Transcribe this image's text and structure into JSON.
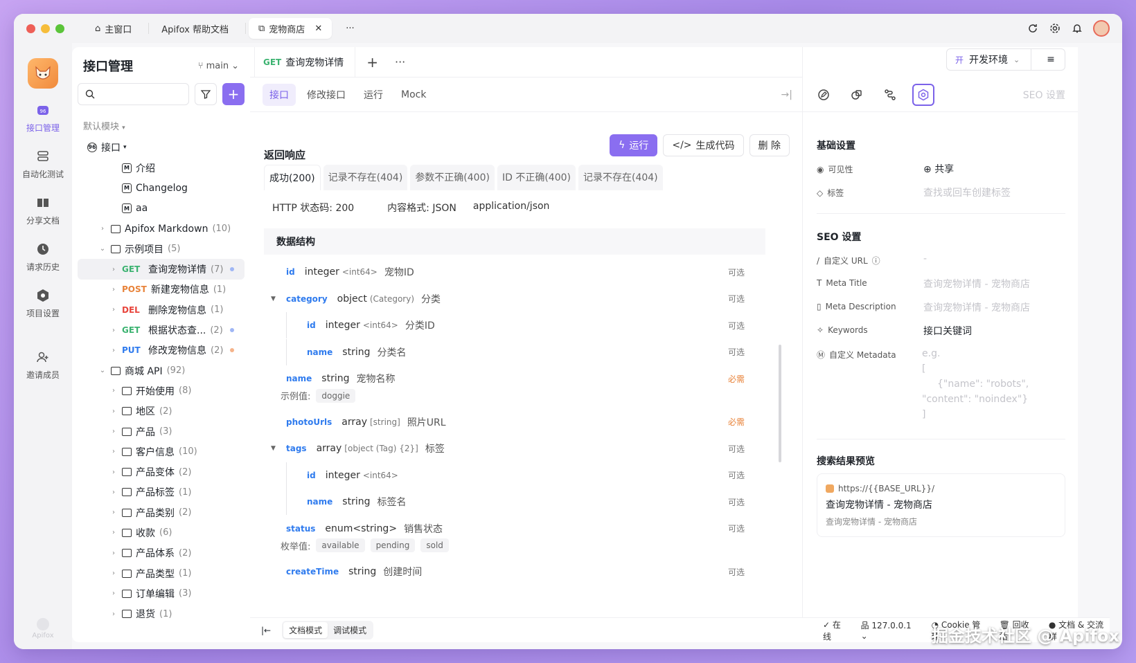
{
  "titlebar": {
    "tabs": [
      "主窗口",
      "Apifox 帮助文档",
      "宠物商店"
    ],
    "more": "···"
  },
  "rail": {
    "items": [
      "接口管理",
      "自动化测试",
      "分享文档",
      "请求历史",
      "项目设置",
      "邀请成员"
    ],
    "bottom": "Apifox"
  },
  "tree": {
    "title": "接口管理",
    "branch": "main",
    "module": "默认模块",
    "root": "接口",
    "items": [
      {
        "type": "doc",
        "label": "介绍",
        "indent": 2
      },
      {
        "type": "doc",
        "label": "Changelog",
        "indent": 2
      },
      {
        "type": "doc",
        "label": "aa",
        "indent": 2
      },
      {
        "type": "folder",
        "label": "Apifox Markdown",
        "count": "(10)",
        "indent": 1,
        "arrow": "›"
      },
      {
        "type": "folder",
        "label": "示例项目",
        "count": "(5)",
        "indent": 1,
        "arrow": "⌄"
      },
      {
        "type": "api",
        "method": "GET",
        "label": "查询宠物详情",
        "count": "(7)",
        "indent": 2,
        "arrow": "›",
        "dot": "#9fb6f5",
        "sel": true
      },
      {
        "type": "api",
        "method": "POST",
        "label": "新建宠物信息",
        "count": "(1)",
        "indent": 2,
        "arrow": "›"
      },
      {
        "type": "api",
        "method": "DEL",
        "label": "删除宠物信息",
        "count": "(1)",
        "indent": 2,
        "arrow": "›"
      },
      {
        "type": "api",
        "method": "GET",
        "label": "根据状态查...",
        "count": "(2)",
        "indent": 2,
        "arrow": "›",
        "dot": "#9fb6f5"
      },
      {
        "type": "api",
        "method": "PUT",
        "label": "修改宠物信息",
        "count": "(2)",
        "indent": 2,
        "arrow": "›",
        "dot": "#f5b38a"
      },
      {
        "type": "folder",
        "label": "商城 API",
        "count": "(92)",
        "indent": 1,
        "arrow": "⌄"
      },
      {
        "type": "folder",
        "label": "开始使用",
        "count": "(8)",
        "indent": 2,
        "arrow": "›"
      },
      {
        "type": "folder",
        "label": "地区",
        "count": "(2)",
        "indent": 2,
        "arrow": "›"
      },
      {
        "type": "folder",
        "label": "产品",
        "count": "(3)",
        "indent": 2,
        "arrow": "›"
      },
      {
        "type": "folder",
        "label": "客户信息",
        "count": "(10)",
        "indent": 2,
        "arrow": "›"
      },
      {
        "type": "folder",
        "label": "产品变体",
        "count": "(2)",
        "indent": 2,
        "arrow": "›"
      },
      {
        "type": "folder",
        "label": "产品标签",
        "count": "(1)",
        "indent": 2,
        "arrow": "›"
      },
      {
        "type": "folder",
        "label": "产品类别",
        "count": "(2)",
        "indent": 2,
        "arrow": "›"
      },
      {
        "type": "folder",
        "label": "收款",
        "count": "(6)",
        "indent": 2,
        "arrow": "›"
      },
      {
        "type": "folder",
        "label": "产品体系",
        "count": "(2)",
        "indent": 2,
        "arrow": "›"
      },
      {
        "type": "folder",
        "label": "产品类型",
        "count": "(1)",
        "indent": 2,
        "arrow": "›"
      },
      {
        "type": "folder",
        "label": "订单编辑",
        "count": "(3)",
        "indent": 2,
        "arrow": "›"
      },
      {
        "type": "folder",
        "label": "退货",
        "count": "(1)",
        "indent": 2,
        "arrow": "›"
      }
    ]
  },
  "main": {
    "tab": {
      "method": "GET",
      "label": "查询宠物详情"
    },
    "subtabs": [
      "接口",
      "修改接口",
      "运行",
      "Mock"
    ],
    "actions": {
      "run": "运行",
      "gen": "生成代码",
      "del": "删 除"
    },
    "section": "返回响应",
    "resp_tabs": [
      "成功(200)",
      "记录不存在(404)",
      "参数不正确(400)",
      "ID 不正确(400)",
      "记录不存在(404)"
    ],
    "meta": [
      "HTTP 状态码: 200",
      "内容格式: JSON",
      "application/json"
    ],
    "ds_title": "数据结构",
    "fields": [
      {
        "name": "id",
        "type": "integer",
        "sub": "<int64>",
        "desc": "宠物ID",
        "req": "可选",
        "level": 0
      },
      {
        "name": "category",
        "type": "object",
        "sub": "(Category)",
        "desc": "分类",
        "req": "可选",
        "level": 0,
        "toggle": true
      },
      {
        "name": "id",
        "type": "integer",
        "sub": "<int64>",
        "desc": "分类ID",
        "req": "可选",
        "level": 1
      },
      {
        "name": "name",
        "type": "string",
        "sub": "",
        "desc": "分类名",
        "req": "可选",
        "level": 1
      },
      {
        "name": "name",
        "type": "string",
        "sub": "",
        "desc": "宠物名称",
        "req": "必需",
        "level": 0,
        "required": true,
        "example_label": "示例值:",
        "examples": [
          "doggie"
        ]
      },
      {
        "name": "photoUrls",
        "type": "array",
        "sub": "[string]",
        "desc": "照片URL",
        "req": "必需",
        "level": 0,
        "required": true
      },
      {
        "name": "tags",
        "type": "array",
        "sub": "[object (Tag) {2}]",
        "desc": "标签",
        "req": "可选",
        "level": 0,
        "toggle": true
      },
      {
        "name": "id",
        "type": "integer",
        "sub": "<int64>",
        "desc": "",
        "req": "可选",
        "level": 1
      },
      {
        "name": "name",
        "type": "string",
        "sub": "",
        "desc": "标签名",
        "req": "可选",
        "level": 1
      },
      {
        "name": "status",
        "type": "enum<string>",
        "sub": "",
        "desc": "销售状态",
        "req": "可选",
        "level": 0,
        "example_label": "枚举值:",
        "examples": [
          "available",
          "pending",
          "sold"
        ]
      },
      {
        "name": "createTime",
        "type": "string",
        "sub": "",
        "desc": "创建时间",
        "req": "可选",
        "level": 0
      }
    ],
    "bottom": {
      "doc_mode": "文档模式",
      "debug_mode": "调试模式"
    }
  },
  "right": {
    "env": {
      "badge": "开",
      "label": "开发环境"
    },
    "seo_label": "SEO 设置",
    "basic": "基础设置",
    "visibility_label": "可见性",
    "visibility_val": "共享",
    "tags_label": "标签",
    "tags_ph": "查找或回车创建标签",
    "seo": "SEO 设置",
    "custom_url_label": "自定义 URL",
    "custom_url_val": "-",
    "meta_title_label": "Meta Title",
    "meta_title_ph": "查询宠物详情 - 宠物商店",
    "meta_desc_label": "Meta Description",
    "meta_desc_ph": "查询宠物详情 - 宠物商店",
    "keywords_label": "Keywords",
    "keywords_val": "接口关键词",
    "custom_meta_label": "自定义 Metadata",
    "custom_meta_ph": [
      "e.g.",
      "[",
      "    {\"name\": \"robots\",",
      "\"content\": \"noindex\"}",
      "]"
    ],
    "preview_title": "搜索结果预览",
    "preview_url": "https://{{BASE_URL}}/",
    "preview_page_title": "查询宠物详情 - 宠物商店",
    "preview_desc": "查询宠物详情 - 宠物商店"
  },
  "status": {
    "online": "在线",
    "host": "127.0.0.1",
    "cookie": "Cookie 管理",
    "recycle": "回收站",
    "docs": "文档 & 交流群"
  },
  "watermark": "掘金技术社区 @ Apifox"
}
